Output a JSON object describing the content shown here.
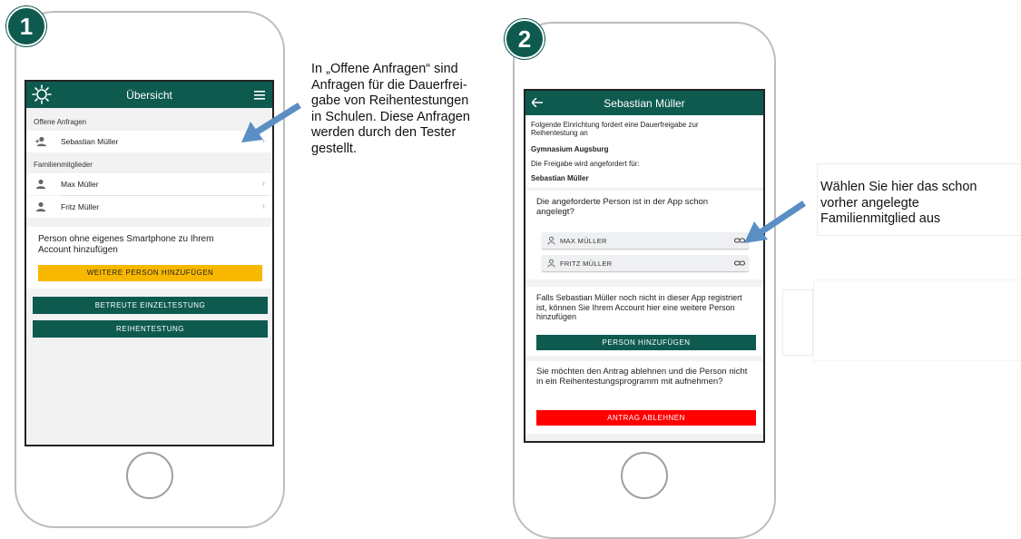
{
  "step1": {
    "badge": "1",
    "appbar": {
      "title": "Übersicht",
      "logo_icon": "sun-logo-icon",
      "menu_icon": "hamburger-menu-icon"
    },
    "section_open_requests": "Offene Anfragen",
    "open_requests": [
      {
        "name": "Sebastian Müller",
        "icon": "person-add-icon"
      }
    ],
    "section_family": "Familienmitglieder",
    "family_members": [
      {
        "name": "Max Müller",
        "icon": "person-icon"
      },
      {
        "name": "Fritz Müller",
        "icon": "person-icon"
      }
    ],
    "add_card_text": "Person ohne eigenes Smartphone zu Ihrem Account hinzufügen",
    "add_person_button": "WEITERE PERSON HINZUFÜGEN",
    "single_test_button": "BETREUTE EINZELTESTUNG",
    "series_test_button": "REIHENTESTUNG",
    "callout": "In „Offene Anfragen“ sind Anfragen für die Dauerfrei-gabe von Reihentestungen in Schulen. Diese Anfragen werden durch den Tester gestellt.",
    "callout_lines": [
      "In „Offene Anfragen“ sind",
      "Anfragen für die Dauerfrei-",
      "gabe von Reihentestungen",
      "in Schulen. Diese Anfragen",
      "werden durch den Tester",
      "gestellt."
    ]
  },
  "step2": {
    "badge": "2",
    "appbar": {
      "title": "Sebastian Müller",
      "back_icon": "arrow-left-icon"
    },
    "intro": "Folgende Einrichtung fordert eine Dauerfreigabe zur Reihentestung an",
    "institution": "Gymnasium Augsburg",
    "requested_for_label": "Die Freigabe wird angefordert für:",
    "requested_person": "Sebastian Müller",
    "question_existing": "Die angeforderte Person ist in der App schon angelegt?",
    "choices": [
      {
        "label": "MAX MÜLLER",
        "icon": "person-outline-icon",
        "action_icon": "link-icon"
      },
      {
        "label": "FRITZ MÜLLER",
        "icon": "person-outline-icon",
        "action_icon": "link-icon"
      }
    ],
    "not_registered_text": "Falls Sebastian Müller noch nicht in dieser App registriert ist, können Sie Ihrem Account hier eine weitere Person hinzufügen",
    "add_person_button": "PERSON HINZUFÜGEN",
    "decline_text": "Sie möchten den Antrag ablehnen und die Person nicht in ein Reihentestungsprogramm mit aufnehmen?",
    "decline_button": "ANTRAG ABLEHNEN",
    "callout_lines": [
      "Wählen Sie hier das schon",
      "vorher angelegte",
      "Familienmitglied aus"
    ]
  },
  "colors": {
    "brand_green": "#0e5a4f",
    "yellow": "#f9b800",
    "red": "#ff0000",
    "arrow_blue": "#5b8ec4"
  }
}
